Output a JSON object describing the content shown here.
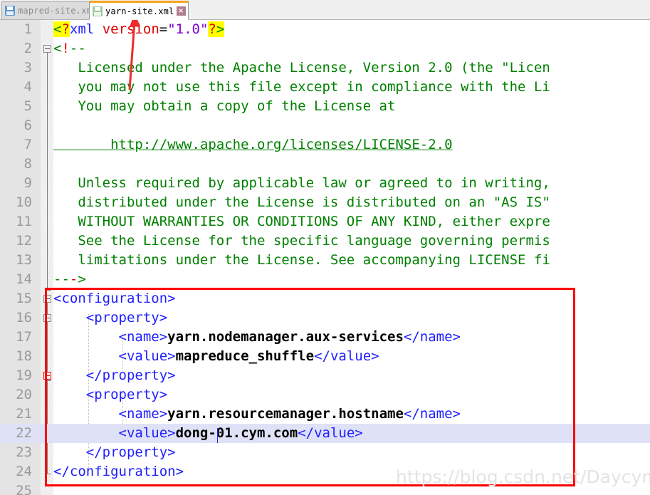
{
  "window": {
    "title": "yarn-site.xml"
  },
  "tabs": [
    {
      "label": "mapred-site.xml",
      "icon": "floppy-disk-icon",
      "close": "×",
      "active": false
    },
    {
      "label": "yarn-site.xml",
      "icon": "floppy-disk-icon",
      "close": "×",
      "active": true
    }
  ],
  "editor": {
    "language": "xml",
    "current_line": 22,
    "caret_after_text": "dong-01",
    "total_visible_lines": 25,
    "lines": [
      {
        "n": "1",
        "text": "<?xml version=\"1.0\"?>"
      },
      {
        "n": "2",
        "text": "<!--"
      },
      {
        "n": "3",
        "text": "   Licensed under the Apache License, Version 2.0 (the \"Licen"
      },
      {
        "n": "4",
        "text": "   you may not use this file except in compliance with the Li"
      },
      {
        "n": "5",
        "text": "   You may obtain a copy of the License at"
      },
      {
        "n": "6",
        "text": ""
      },
      {
        "n": "7",
        "text": "       http://www.apache.org/licenses/LICENSE-2.0"
      },
      {
        "n": "8",
        "text": ""
      },
      {
        "n": "9",
        "text": "   Unless required by applicable law or agreed to in writing,"
      },
      {
        "n": "10",
        "text": "   distributed under the License is distributed on an \"AS IS\""
      },
      {
        "n": "11",
        "text": "   WITHOUT WARRANTIES OR CONDITIONS OF ANY KIND, either expre"
      },
      {
        "n": "12",
        "text": "   See the License for the specific language governing permis"
      },
      {
        "n": "13",
        "text": "   limitations under the License. See accompanying LICENSE fi"
      },
      {
        "n": "14",
        "text": "-->"
      },
      {
        "n": "15",
        "text": "<configuration>"
      },
      {
        "n": "16",
        "text": "    <property>"
      },
      {
        "n": "17",
        "text": "        <name>yarn.nodemanager.aux-services</name>"
      },
      {
        "n": "18",
        "text": "        <value>mapreduce_shuffle</value>"
      },
      {
        "n": "19",
        "text": "    </property>"
      },
      {
        "n": "20",
        "text": "    <property>"
      },
      {
        "n": "21",
        "text": "        <name>yarn.resourcemanager.hostname</name>"
      },
      {
        "n": "22",
        "text": "        <value>dong-01.cym.com</value>"
      },
      {
        "n": "23",
        "text": "    </property>"
      },
      {
        "n": "24",
        "text": "</configuration>"
      },
      {
        "n": "25",
        "text": ""
      }
    ],
    "xml_properties": [
      {
        "name": "yarn.nodemanager.aux-services",
        "value": "mapreduce_shuffle"
      },
      {
        "name": "yarn.resourcemanager.hostname",
        "value": "dong-01.cym.com"
      }
    ]
  },
  "annotations": {
    "red_box_label": "configuration-block-highlight",
    "red_arrow_label": "pointer-to-active-tab",
    "watermark": "https://blog.csdn.net/Daycym"
  },
  "colors": {
    "tab_active_accent": "#f5a623",
    "comment_green": "#008000",
    "tag_blue": "#2020ff",
    "attr_red": "#e00000",
    "string_purple": "#8000d0",
    "highlight_yellow": "#ffff00",
    "current_line": "#dfe2f7",
    "annotation_red": "#ff0000"
  }
}
